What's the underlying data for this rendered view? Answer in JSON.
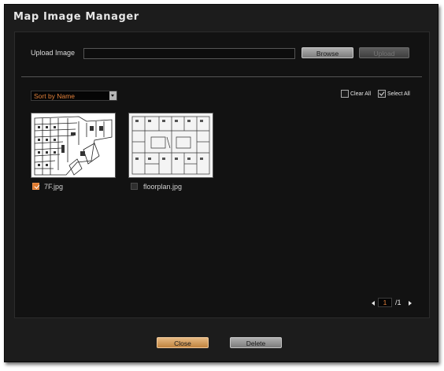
{
  "dialog": {
    "title": "Map Image Manager"
  },
  "upload": {
    "label": "Upload Image",
    "path_value": "",
    "browse_label": "Browse",
    "upload_label": "Upload"
  },
  "sort": {
    "selected": "Sort by Name"
  },
  "selection": {
    "clear_all": "Clear All",
    "select_all": "Select All",
    "clear_all_checked": false,
    "select_all_checked": true
  },
  "files": [
    {
      "name": "7F.jpg",
      "checked": true
    },
    {
      "name": "floorplan.jpg",
      "checked": false
    }
  ],
  "pager": {
    "current": "1",
    "total": "/1"
  },
  "footer": {
    "close_label": "Close",
    "delete_label": "Delete"
  },
  "colors": {
    "accent": "#e07a2f",
    "background": "#1c1c1c",
    "panel": "#121212"
  }
}
